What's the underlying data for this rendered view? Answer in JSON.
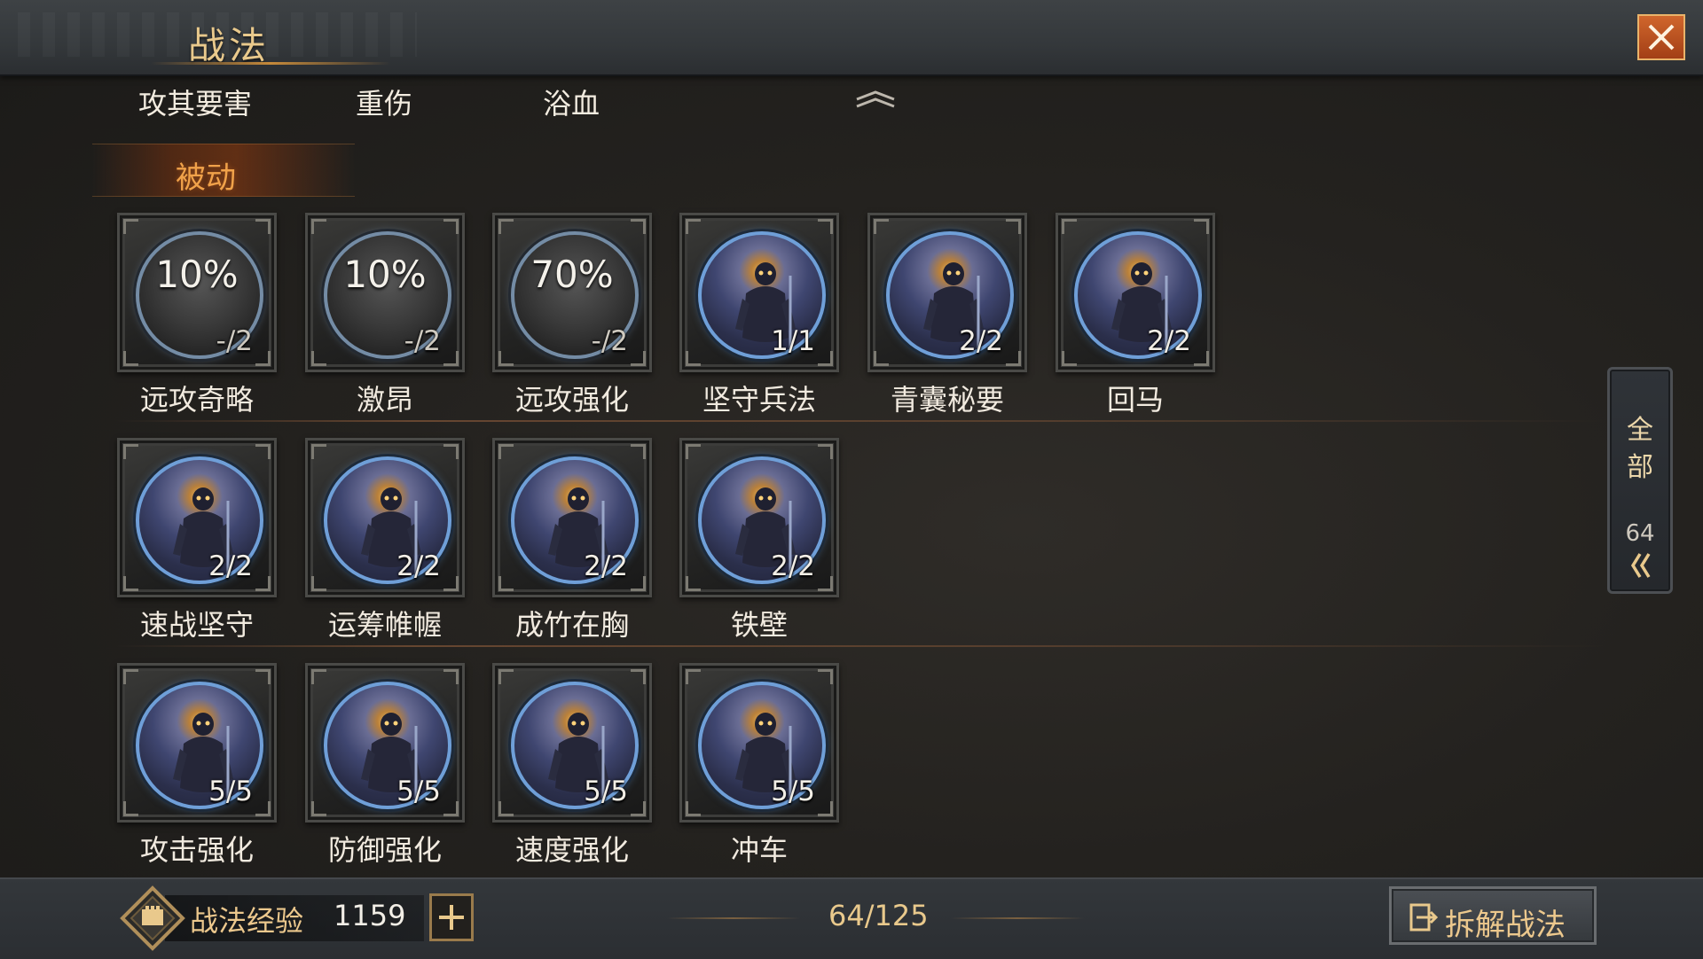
{
  "header": {
    "title": "战法",
    "close_icon": "close-icon"
  },
  "tabs": [
    "攻其要害",
    "重伤",
    "浴血"
  ],
  "section": {
    "title": "被动"
  },
  "skills": [
    {
      "name": "远攻奇略",
      "state": "locked",
      "progress": "10%",
      "count": "-/2"
    },
    {
      "name": "激昂",
      "state": "locked",
      "progress": "10%",
      "count": "-/2"
    },
    {
      "name": "远攻强化",
      "state": "locked",
      "progress": "70%",
      "count": "-/2"
    },
    {
      "name": "坚守兵法",
      "state": "active",
      "progress": "",
      "count": "1/1"
    },
    {
      "name": "青囊秘要",
      "state": "active",
      "progress": "",
      "count": "2/2"
    },
    {
      "name": "回马",
      "state": "active",
      "progress": "",
      "count": "2/2"
    },
    {
      "name": "速战坚守",
      "state": "active",
      "progress": "",
      "count": "2/2"
    },
    {
      "name": "运筹帷幄",
      "state": "active",
      "progress": "",
      "count": "2/2"
    },
    {
      "name": "成竹在胸",
      "state": "active",
      "progress": "",
      "count": "2/2"
    },
    {
      "name": "铁壁",
      "state": "active",
      "progress": "",
      "count": "2/2"
    },
    {
      "name": "攻击强化",
      "state": "active",
      "progress": "",
      "count": "5/5"
    },
    {
      "name": "防御强化",
      "state": "active",
      "progress": "",
      "count": "5/5"
    },
    {
      "name": "速度强化",
      "state": "active",
      "progress": "",
      "count": "5/5"
    },
    {
      "name": "冲车",
      "state": "active",
      "progress": "",
      "count": "5/5"
    }
  ],
  "filter": {
    "label_1": "全",
    "label_2": "部",
    "count": "64"
  },
  "footer": {
    "exp_label": "战法经验",
    "exp_value": "1159",
    "capacity": "64/125",
    "decompose_label": "拆解战法"
  },
  "colors": {
    "accent": "#e9c98c",
    "orb_ring": "#6f9fd8",
    "close_bg": "#c0521f"
  }
}
